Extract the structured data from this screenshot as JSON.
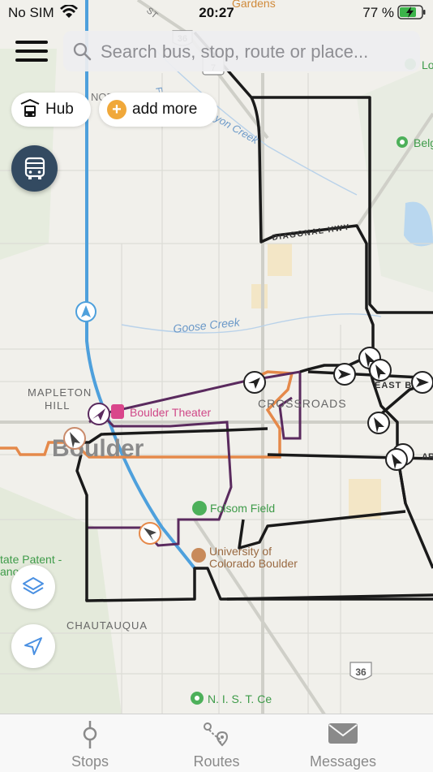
{
  "status_bar": {
    "carrier": "No SIM",
    "time": "20:27",
    "battery": "77 %"
  },
  "search": {
    "placeholder": "Search bus, stop, route or place..."
  },
  "chips": {
    "hub": "Hub",
    "add_more": "add more"
  },
  "map": {
    "places": {
      "gardens": "Gardens",
      "lo": "Lo",
      "belg": "Belg",
      "nor": "NOR",
      "boulder_theater": "Boulder Theater",
      "folsom_field": "Folsom Field",
      "university_line1": "University of",
      "university_line2": "Colorado Boulder",
      "state_patent_line1": "tate Patent -",
      "state_patent_line2": "anorama",
      "nist": "N. I. S. T. Ce"
    },
    "areas": {
      "boulder": "Boulder",
      "crossroads": "CROSSROADS",
      "mapleton_hill_line1": "MAPLETON",
      "mapleton_hill_line2": "HILL",
      "chautauqua": "CHAUTAUQUA"
    },
    "waterways": {
      "goose_creek": "Goose Creek",
      "boulder_creek": "yon Creek",
      "fo": "Fo"
    },
    "roads": {
      "diagonal_hwy": "DIAGONAL HWY",
      "east_b": "EAST B",
      "st": "ST",
      "ar": "AR"
    },
    "shields": {
      "us36_north": "36",
      "us36_south": "36",
      "route7": "7"
    }
  },
  "colors": {
    "accent_dark": "#334a61",
    "add_more_orange": "#f0a83a",
    "route_blue": "#4ea0dc",
    "route_orange": "#e5894a",
    "route_purple": "#5a2a5e",
    "route_black": "#1a1a1a",
    "poi_green": "#4db05a",
    "poi_pink": "#d9468b"
  },
  "tabs": [
    {
      "label": "Stops",
      "icon": "stops-icon"
    },
    {
      "label": "Routes",
      "icon": "routes-icon"
    },
    {
      "label": "Messages",
      "icon": "messages-icon"
    }
  ]
}
